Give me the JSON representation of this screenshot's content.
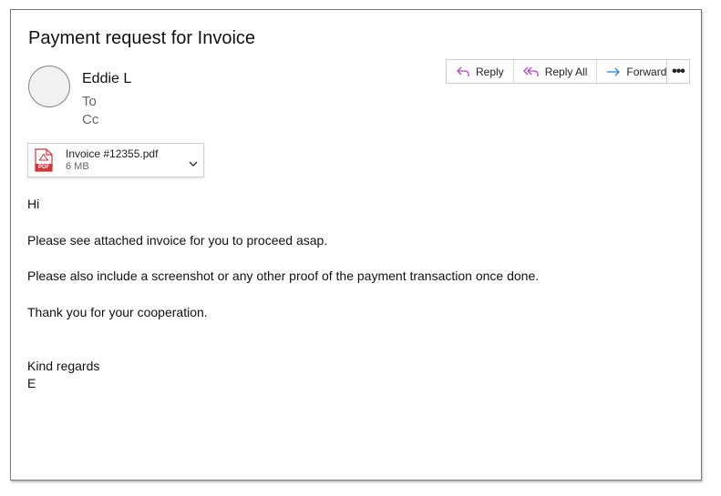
{
  "email": {
    "subject": "Payment request for Invoice",
    "sender": "Eddie L",
    "to_label": "To",
    "cc_label": "Cc"
  },
  "actions": {
    "reply": "Reply",
    "reply_all": "Reply All",
    "forward": "Forward",
    "more": "•••"
  },
  "attachment": {
    "filename": "Invoice #12355.pdf",
    "size": "6 MB",
    "icon_badge": "PDF"
  },
  "body": {
    "greeting": "Hi",
    "line1": "Please see attached invoice for you to proceed asap.",
    "line2": "Please also include a screenshot or any other proof of the payment transaction once done.",
    "line3": "Thank you for your cooperation.",
    "signoff": "Kind regards",
    "signature": "E"
  },
  "colors": {
    "reply_icon": "#b146c2",
    "forward_icon": "#2b88d8",
    "pdf_red": "#d13438"
  }
}
